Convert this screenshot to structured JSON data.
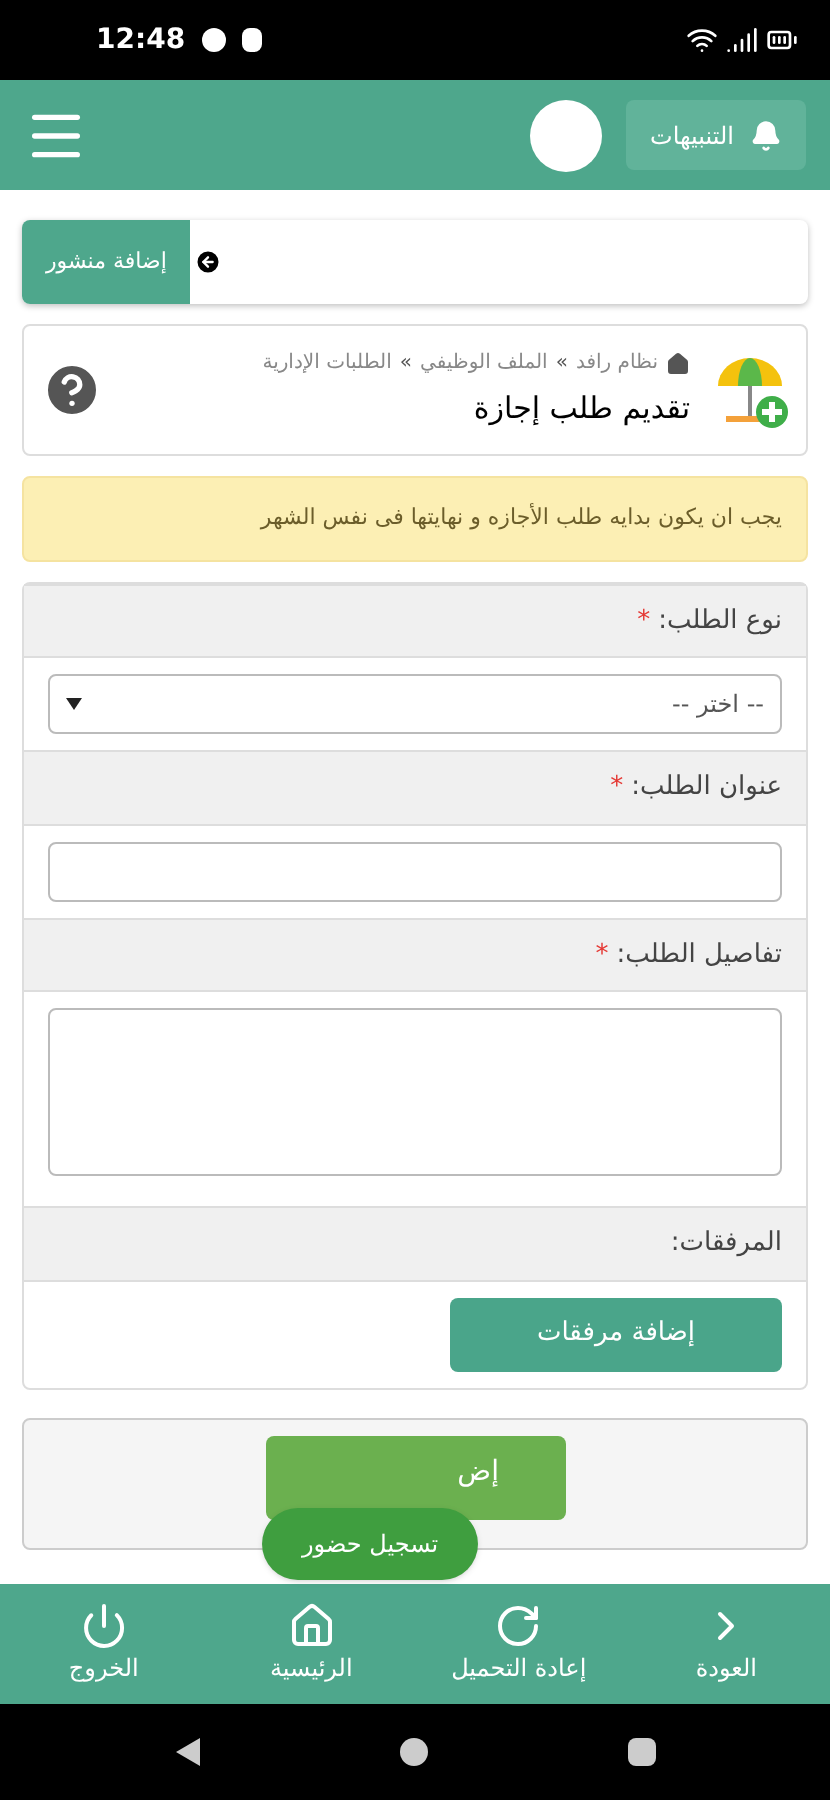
{
  "status_bar": {
    "time": "12:48"
  },
  "header": {
    "notifications_label": "التنبيهات"
  },
  "post_bar": {
    "button": "إضافة منشور"
  },
  "page": {
    "breadcrumb": [
      {
        "label": "نظام رافد"
      },
      {
        "separator": "»",
        "label": "الملف الوظيفي"
      },
      {
        "separator": "»",
        "label": "الطلبات الإدارية"
      }
    ],
    "title": "تقديم طلب إجازة"
  },
  "alert": "يجب ان يكون بدايه طلب الأجازه و نهايتها فى نفس الشهر",
  "form": {
    "required_marker": "*",
    "fields": [
      {
        "kind": "select",
        "label": "نوع الطلب:",
        "required": true,
        "value": "-- اختر --"
      },
      {
        "kind": "text",
        "label": "عنوان الطلب:",
        "required": true
      },
      {
        "kind": "textarea",
        "label": "تفاصيل الطلب:",
        "required": true
      },
      {
        "kind": "attachments",
        "label": "المرفقات:",
        "required": false,
        "button": "إضافة مرفقات"
      }
    ]
  },
  "submit_button": "إض",
  "floating_button": "تسجيل حضور",
  "bottom_nav": [
    {
      "kind": "back",
      "label": "العودة"
    },
    {
      "kind": "reload",
      "label": "إعادة التحميل"
    },
    {
      "kind": "home",
      "label": "الرئيسية"
    },
    {
      "kind": "logout",
      "label": "الخروج"
    }
  ]
}
